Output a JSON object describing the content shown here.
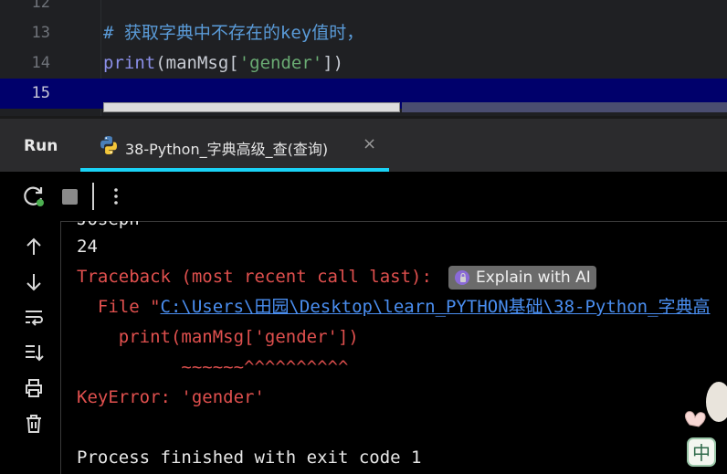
{
  "editor": {
    "lines": [
      {
        "num": "12",
        "segments": []
      },
      {
        "num": "13",
        "segments": [
          {
            "cls": "c-comment",
            "text": "# 获取字典中不存在的key值时，"
          }
        ]
      },
      {
        "num": "14",
        "segments": [
          {
            "cls": "c-fn",
            "text": "print"
          },
          {
            "cls": "c-id",
            "text": "(manMsg["
          },
          {
            "cls": "c-str",
            "text": "'gender'"
          },
          {
            "cls": "c-id",
            "text": "])"
          }
        ]
      },
      {
        "num": "15",
        "segments": [],
        "current": true
      }
    ]
  },
  "run": {
    "title": "Run",
    "tab_label": "38-Python_字典高级_查(查询)",
    "tab_close": "×"
  },
  "console": {
    "partial_line": "Joseph",
    "age_line": "24",
    "traceback_line": "Traceback (most recent call last):",
    "explain_label": "Explain with AI",
    "file_prefix": "  File \"",
    "file_path": "C:\\Users\\田园\\Desktop\\learn_PYTHON基础\\38-Python_字典高",
    "code_line": "    print(manMsg['gender'])",
    "caret_line": "          ~~~~~~^^^^^^^^^^",
    "error_line": "KeyError: 'gender'",
    "blank_line": "",
    "exit_line": "Process finished with exit code 1"
  },
  "decoration": {
    "text": "中"
  },
  "colors": {
    "accent": "#1ad2f5",
    "error": "#e0504e",
    "link": "#4a8ef0",
    "current_line": "#00006b"
  }
}
